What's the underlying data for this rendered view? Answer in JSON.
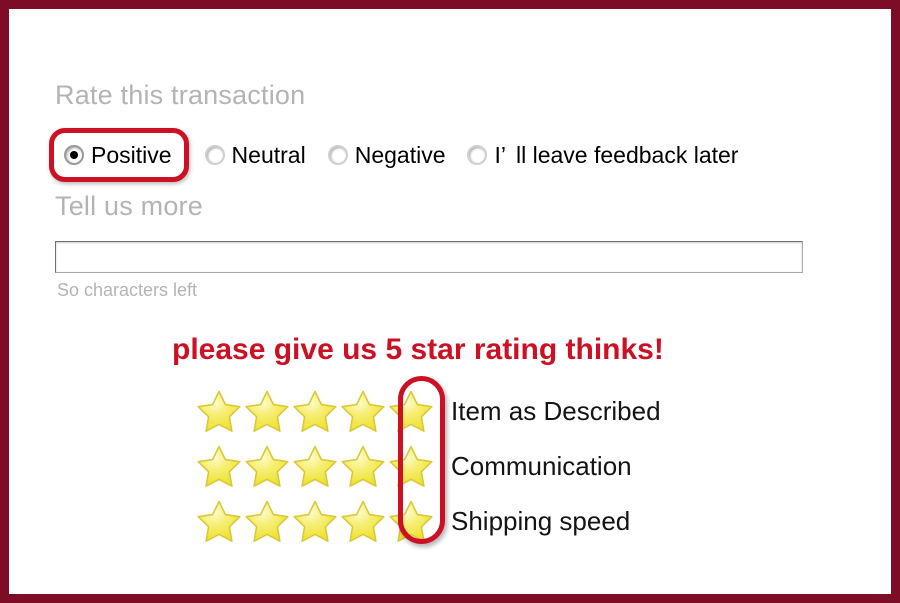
{
  "colors": {
    "frame": "#7d0c26",
    "accent_red": "#cc1124",
    "heading_gray": "#b4b4b4",
    "star_yellow": "#f2e23c",
    "text_black": "#141414"
  },
  "rate_section": {
    "heading": "Rate this transaction",
    "options": [
      {
        "label": "Positive",
        "selected": true,
        "emphasised": true
      },
      {
        "label": "Neutral",
        "selected": false,
        "emphasised": false
      },
      {
        "label": "Negative",
        "selected": false,
        "emphasised": false
      },
      {
        "label_part1": "I’",
        "label_part2": "ll leave feedback later",
        "selected": false,
        "emphasised": false
      }
    ]
  },
  "tell_section": {
    "heading": "Tell us more",
    "input_value": "",
    "input_placeholder": "",
    "char_counter": "So characters left"
  },
  "promo": {
    "text": "please give us 5 star rating thinks!"
  },
  "ratings": {
    "max_stars": 5,
    "highlighted_column": 5,
    "rows": [
      {
        "label": "Item as Described",
        "stars": 5
      },
      {
        "label": "Communication",
        "stars": 5
      },
      {
        "label": "Shipping speed",
        "stars": 5
      }
    ]
  }
}
